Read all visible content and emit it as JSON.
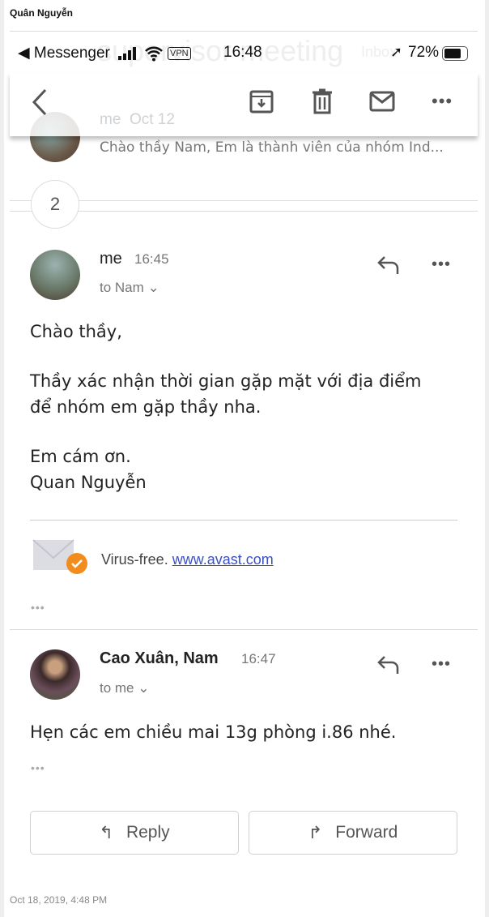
{
  "window_title": "Quân Nguyễn",
  "status_bar": {
    "back_app": "Messenger",
    "vpn": "VPN",
    "time": "16:48",
    "battery": "72%"
  },
  "background": {
    "subject_fragment": "supervisor meeting",
    "label": "Inbox"
  },
  "collapsed_message": {
    "sender": "me",
    "date": "Oct 12",
    "snippet": "Chào thầy Nam, Em là thành viên của nhóm Ind..."
  },
  "hidden_count": "2",
  "messages": [
    {
      "sender": "me",
      "time": "16:45",
      "recipient": "to Nam",
      "body": [
        "Chào thầy,",
        "Thầy xác nhận thời gian gặp mặt với địa điểm",
        "để nhóm em gặp thầy nha.",
        "Em cám ơn.",
        "Quan Nguyễn"
      ],
      "signature": {
        "text": "Virus-free.",
        "link": "www.avast.com"
      }
    },
    {
      "sender": "Cao Xuân, Nam",
      "time": "16:47",
      "recipient": "to me",
      "body": [
        "Hẹn các em chiều mai 13g phòng i.86 nhé."
      ]
    }
  ],
  "actions": {
    "reply": "Reply",
    "forward": "Forward"
  },
  "footer_timestamp": "Oct 18, 2019, 4:48 PM",
  "colors": {
    "link": "#3b4fc4",
    "badge": "#f28c1c"
  }
}
